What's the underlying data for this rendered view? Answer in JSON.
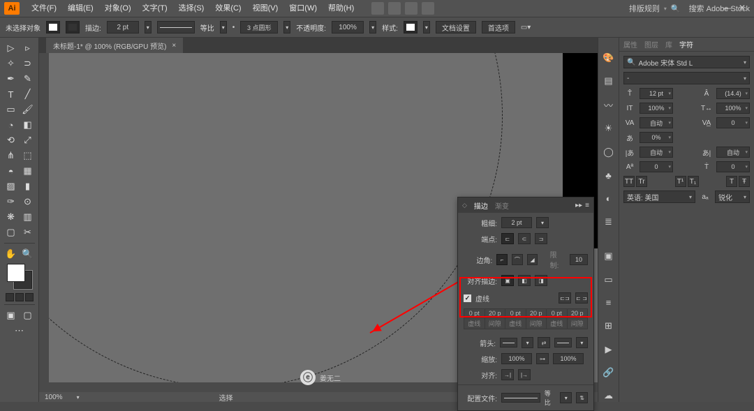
{
  "menu": {
    "items": [
      "文件(F)",
      "编辑(E)",
      "对象(O)",
      "文字(T)",
      "选择(S)",
      "效果(C)",
      "视图(V)",
      "窗口(W)",
      "帮助(H)"
    ],
    "right_label": "排版规则",
    "search_placeholder": "搜索 Adobe Stock"
  },
  "ctrl": {
    "no_selection": "未选择对象",
    "stroke_label": "描边:",
    "stroke_weight": "2 pt",
    "uniform": "等比",
    "brush": "3 点圆形",
    "opacity_label": "不透明度:",
    "opacity": "100%",
    "style_label": "样式:",
    "doc_setup": "文档设置",
    "prefs": "首选项"
  },
  "tab": {
    "title": "未标题-1* @ 100% (RGB/GPU 预览)"
  },
  "status": {
    "zoom": "100%",
    "mode": "选择"
  },
  "stroke": {
    "tab1": "描边",
    "tab2": "渐变",
    "weight_label": "粗细:",
    "weight": "2 pt",
    "cap_label": "端点:",
    "corner_label": "边角:",
    "miter": "10",
    "align_label": "对齐描边:",
    "dash_checkbox": "虚线",
    "dash_vals": [
      "0 pt",
      "20 p",
      "0 pt",
      "20 p",
      "0 pt",
      "20 p"
    ],
    "dash_hdrs": [
      "虚线",
      "间隙",
      "虚线",
      "间隙",
      "虚线",
      "间隙"
    ],
    "arrow_label": "箭头:",
    "scale_label": "缩放:",
    "scale1": "100%",
    "scale2": "100%",
    "align_arrow": "对齐:",
    "profile_label": "配置文件:",
    "profile": "等比"
  },
  "char": {
    "tabs": [
      "属性",
      "图层",
      "库",
      "字符"
    ],
    "font": "Adobe 宋体 Std L",
    "style": "-",
    "size": "12 pt",
    "leading": "(14.4)",
    "hscale": "100%",
    "vscale": "100%",
    "kerning": "自动",
    "tracking": "0",
    "baseline": "0%",
    "rotate": "自动",
    "tsume": "0",
    "aki": "0",
    "tt": "TT",
    "tr": "Tr",
    "t1": "T¹",
    "t2": "T₁",
    "tcap": "T",
    "tstrike": "Ŧ",
    "lang_label": "英语: 美国",
    "aa_label": "锐化",
    "aa_prefix": "aₐ"
  },
  "watermark": "姜无二"
}
